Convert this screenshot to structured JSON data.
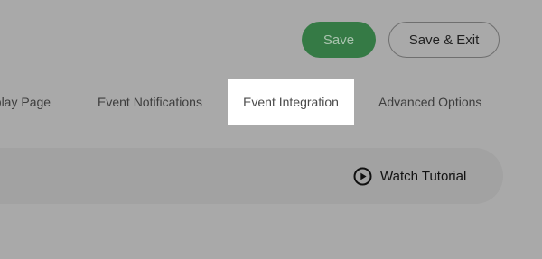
{
  "header": {
    "save_label": "Save",
    "save_exit_label": "Save & Exit"
  },
  "tabs": [
    {
      "label": "eplay Page",
      "active": false
    },
    {
      "label": "Event Notifications",
      "active": false
    },
    {
      "label": "Event Integration",
      "active": true
    },
    {
      "label": "Advanced Options",
      "active": false
    }
  ],
  "tutorial": {
    "label": "Watch Tutorial",
    "icon": "play-circle-icon"
  },
  "colors": {
    "background": "#a9a9a9",
    "save_button": "#357a45",
    "active_tab": "#ffffff"
  }
}
